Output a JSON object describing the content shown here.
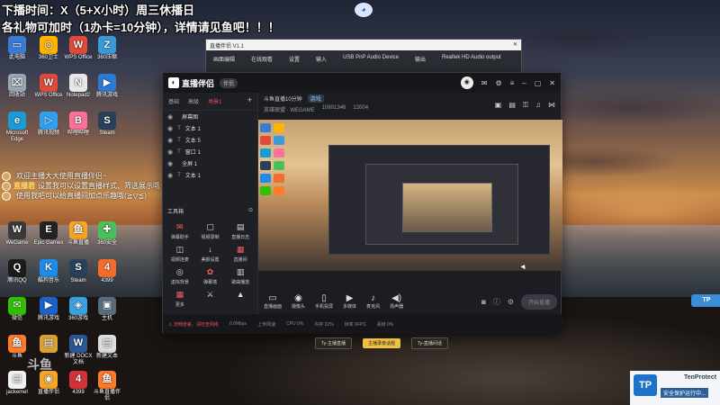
{
  "banner": {
    "line1": "下播时间：X（5+X小时）周三休播日",
    "line2": "各礼物可加时（1办卡=10分钟），详情请见鱼吧！！！"
  },
  "chat": [
    {
      "name": "",
      "text": "欢迎主播大大使用直播伴侣~"
    },
    {
      "name": "直播君",
      "text": "设置我可以设置直播样式、筛选展示哦~"
    },
    {
      "name": "",
      "text": "使用我吧可以给直播间加点乐趣哦(≧▽≦)"
    }
  ],
  "desktop_icons": [
    {
      "label": "此电脑",
      "color": "#3a7bd5",
      "glyph": "▭"
    },
    {
      "label": "360卫士",
      "color": "#ffb400",
      "glyph": "◎"
    },
    {
      "label": "WPS Office",
      "color": "#e04a3a",
      "glyph": "W"
    },
    {
      "label": "360压缩",
      "color": "#3a9ad9",
      "glyph": "Z"
    },
    {
      "label": "回收站",
      "color": "#9aa6b8",
      "glyph": "⌧"
    },
    {
      "label": "WPS Office",
      "color": "#e04a3a",
      "glyph": "W"
    },
    {
      "label": "Notepad2",
      "color": "#e7e7e7",
      "glyph": "N"
    },
    {
      "label": "腾讯游戏",
      "color": "#2c7ad6",
      "glyph": "▶"
    },
    {
      "label": "Microsoft Edge",
      "color": "#1b9ad8",
      "glyph": "e"
    },
    {
      "label": "腾讯视频",
      "color": "#2fa0f0",
      "glyph": "▷"
    },
    {
      "label": "哔哩哔哩",
      "color": "#fb7299",
      "glyph": "B"
    },
    {
      "label": "Steam",
      "color": "#2a3f5a",
      "glyph": "S"
    },
    {
      "label": "WeGame",
      "color": "#3a3a3a",
      "glyph": "W"
    },
    {
      "label": "Epic Games",
      "color": "#222",
      "glyph": "E"
    },
    {
      "label": "斗鱼直播",
      "color": "#f5a623",
      "glyph": "鱼"
    },
    {
      "label": "360安全",
      "color": "#4bbf5a",
      "glyph": "✚"
    },
    {
      "label": "腾讯QQ",
      "color": "#1b1b1b",
      "glyph": "Q"
    },
    {
      "label": "酷狗音乐",
      "color": "#1f8cea",
      "glyph": "K"
    },
    {
      "label": "Steam",
      "color": "#2a3f5a",
      "glyph": "S"
    },
    {
      "label": "4399",
      "color": "#f46c2b",
      "glyph": "4"
    },
    {
      "label": "微信",
      "color": "#2dc100",
      "glyph": "✉"
    },
    {
      "label": "腾讯游戏",
      "color": "#1e62c8",
      "glyph": "▶"
    },
    {
      "label": "360游戏",
      "color": "#3aa0e0",
      "glyph": "◈"
    },
    {
      "label": "主机",
      "color": "#5a6b7a",
      "glyph": "▣"
    },
    {
      "label": "斗鱼",
      "color": "#ff7a2a",
      "glyph": "鱼"
    },
    {
      "label": "",
      "color": "#d9a233",
      "glyph": "▤"
    },
    {
      "label": "新建 DOCX 文档",
      "color": "#2b5797",
      "glyph": "W"
    },
    {
      "label": "新建文本",
      "color": "#ddd",
      "glyph": "▤"
    },
    {
      "label": "jackemel",
      "color": "#f1f1f1",
      "glyph": "▤"
    },
    {
      "label": "直播伴侣",
      "color": "#f5a623",
      "glyph": "◉"
    },
    {
      "label": "4399",
      "color": "#d13438",
      "glyph": "4"
    },
    {
      "label": "斗鱼直播伴侣",
      "color": "#ff7a2a",
      "glyph": "鱼"
    }
  ],
  "back_window": {
    "title": "直播伴侣 V1.1",
    "tabs": [
      "画面编辑",
      "在线观看",
      "设置",
      "输入",
      "USB PnP Audio Device",
      "输出",
      "Realtek HD Audio output"
    ]
  },
  "app": {
    "title": "直播伴侣",
    "version_badge": "伴侣",
    "left_tabs": [
      "基础",
      "高级",
      "场景1"
    ],
    "sources": [
      {
        "name": "屏幕图",
        "type": ""
      },
      {
        "name": "文本 1",
        "type": "T"
      },
      {
        "name": "文本 5",
        "type": "T"
      },
      {
        "name": "窗口 1",
        "type": "T"
      },
      {
        "name": "全屏 1",
        "type": ""
      },
      {
        "name": "文本 1",
        "type": "T"
      }
    ],
    "tools_title": "工具箱",
    "tools": [
      {
        "label": "弹幕助手",
        "icon": "✉",
        "red": true
      },
      {
        "label": "视频录制",
        "icon": "▢",
        "red": false
      },
      {
        "label": "直播日志",
        "icon": "▤",
        "red": false
      },
      {
        "label": "视频连麦",
        "icon": "◫",
        "red": false
      },
      {
        "label": "美颜设置",
        "icon": "↓",
        "red": false
      },
      {
        "label": "直播间",
        "icon": "▦",
        "red": true
      },
      {
        "label": "虚拟背景",
        "icon": "◎",
        "red": false
      },
      {
        "label": "弹幕墙",
        "icon": "✿",
        "red": true
      },
      {
        "label": "歌曲播放",
        "icon": "▥",
        "red": false
      },
      {
        "label": "更多",
        "icon": "▦",
        "red": true
      },
      {
        "label": "",
        "icon": "⚔",
        "red": false
      },
      {
        "label": "",
        "icon": "▲",
        "red": false
      }
    ],
    "room": {
      "title": "斗鱼直播10分钟",
      "tag": "游戏",
      "category": "英雄联盟 · WEGAME",
      "room_id": "10801346",
      "count": "12004"
    },
    "controls": [
      {
        "label": "直播画面",
        "icon": "▭"
      },
      {
        "label": "摄像头",
        "icon": "◉"
      },
      {
        "label": "手机投屏",
        "icon": "▯"
      },
      {
        "label": "多媒体",
        "icon": "▶"
      },
      {
        "label": "麦克风",
        "icon": "♪"
      },
      {
        "label": "扬声器",
        "icon": "◀)"
      }
    ],
    "start_label": "开始直播",
    "status": [
      "0.0Mbps",
      "上传网速",
      "CPU 0%",
      "内存 32%",
      "帧率 0FPS",
      "丢帧 0%"
    ],
    "status_warn": "⚠ 流畅度差，请检查网络"
  },
  "lower_strip": {
    "pill1": "Ty-主播直播",
    "pill2": "Ty-直播间话",
    "pill3": "主播录像话题"
  },
  "toast": {
    "brand": "TP",
    "title": "TenProtect",
    "message": "安全保护运行中..."
  },
  "watermark": "斗鱼"
}
